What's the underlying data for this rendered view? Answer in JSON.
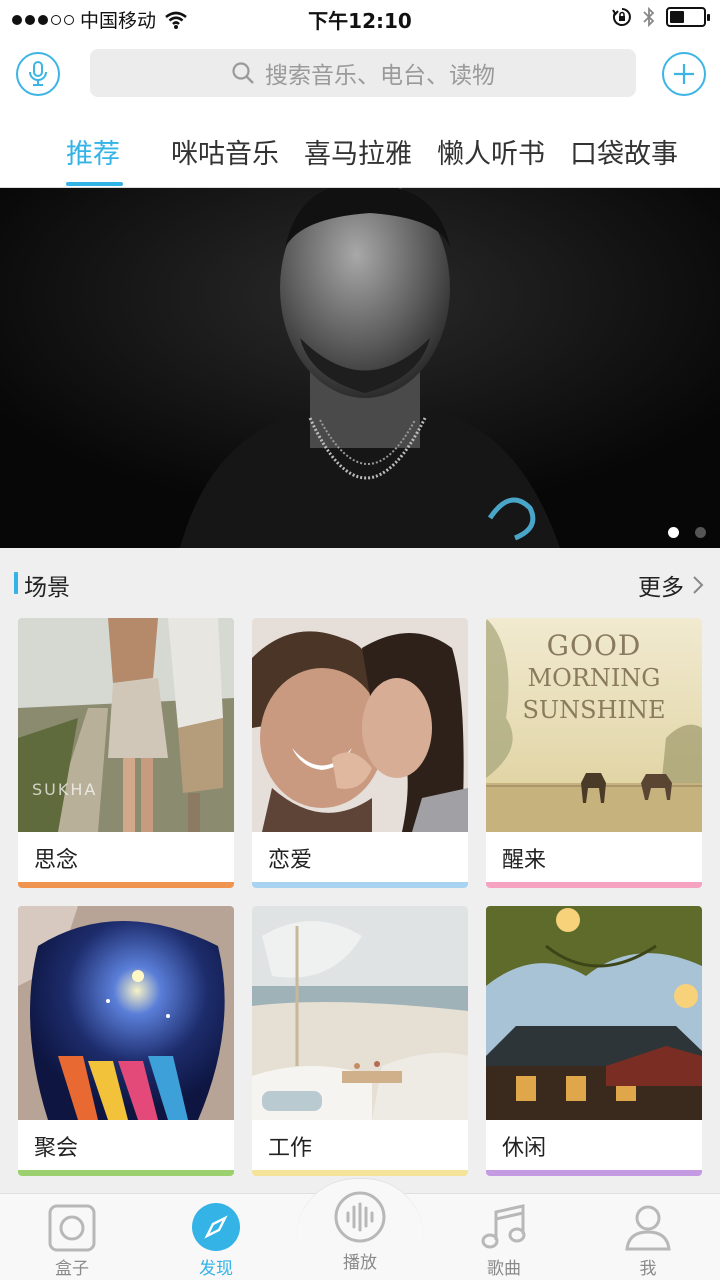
{
  "status_bar": {
    "carrier": "中国移动",
    "time": "下午12:10",
    "signal_dots": 5,
    "signal_filled": 3,
    "battery_level": 0.45
  },
  "header": {
    "search": {
      "placeholder": "搜索音乐、电台、读物"
    },
    "tabs": [
      {
        "label": "推荐",
        "active": true
      },
      {
        "label": "咪咕音乐",
        "active": false
      },
      {
        "label": "喜马拉雅",
        "active": false
      },
      {
        "label": "懒人听书",
        "active": false
      },
      {
        "label": "口袋故事",
        "active": false
      }
    ]
  },
  "banner": {
    "pages": 2,
    "current_page": 1
  },
  "scenes": {
    "title": "场景",
    "more_label": "更多",
    "cards": [
      {
        "label": "思念",
        "strip_color": "#f0954f",
        "photo_text": "SUKHA"
      },
      {
        "label": "恋爱",
        "strip_color": "#a8d4f2"
      },
      {
        "label": "醒来",
        "strip_color": "#f5a3c0",
        "photo_text": [
          "GOOD",
          "MORNING",
          "SUNSHINE"
        ]
      },
      {
        "label": "聚会",
        "strip_color": "#9ccf6e"
      },
      {
        "label": "工作",
        "strip_color": "#f5e39a"
      },
      {
        "label": "休闲",
        "strip_color": "#c49be3"
      }
    ]
  },
  "bottom_nav": {
    "items": [
      {
        "label": "盒子",
        "icon": "box-icon",
        "active": false
      },
      {
        "label": "发现",
        "icon": "compass-icon",
        "active": true
      },
      {
        "label": "播放",
        "icon": "waveform-icon",
        "active": false
      },
      {
        "label": "歌曲",
        "icon": "music-note-icon",
        "active": false
      },
      {
        "label": "我",
        "icon": "user-icon",
        "active": false
      }
    ]
  },
  "colors": {
    "accent": "#33b3e6",
    "background": "#efefef"
  }
}
